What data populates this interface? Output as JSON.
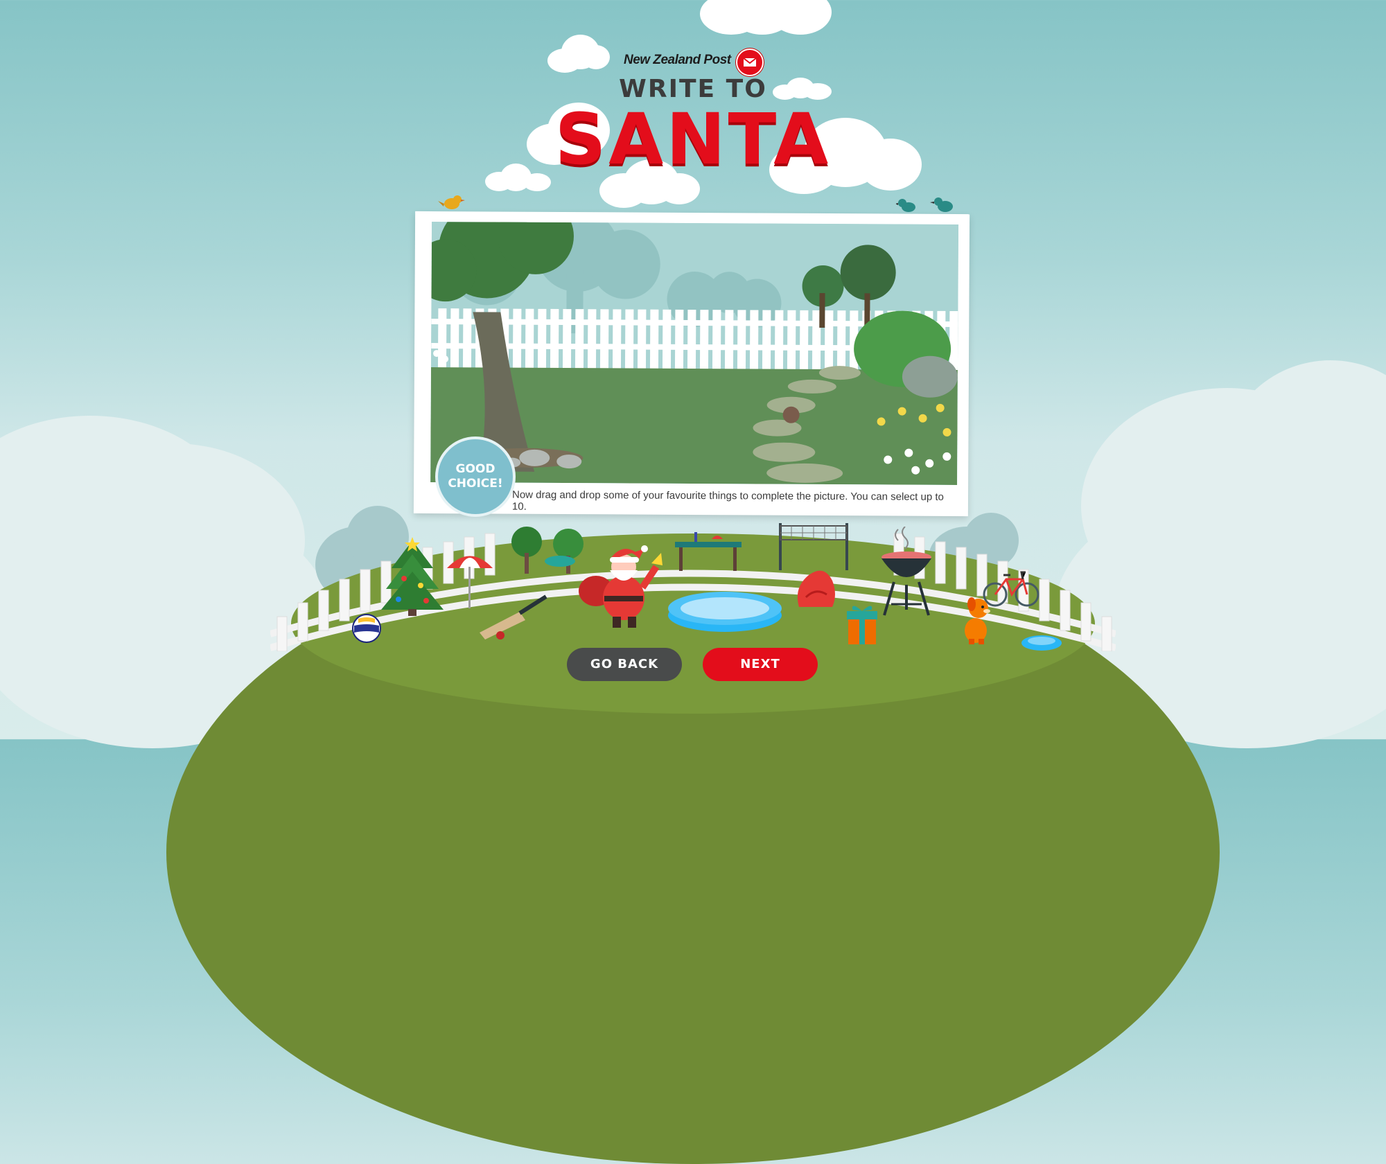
{
  "header": {
    "brand_name": "New Zealand Post",
    "title_line1": "WRITE TO",
    "title_line2": "SANTA"
  },
  "card": {
    "badge_text": "GOOD CHOICE!",
    "instruction": "Now drag and drop some of your favourite things to complete the picture. You can select up to 10."
  },
  "buttons": {
    "back_label": "GO BACK",
    "next_label": "NEXT"
  },
  "items": [
    {
      "name": "christmas-tree",
      "icon": "tree-icon"
    },
    {
      "name": "beach-umbrella",
      "icon": "umbrella-icon"
    },
    {
      "name": "trees",
      "icon": "trees-icon"
    },
    {
      "name": "hammock",
      "icon": "hammock-icon"
    },
    {
      "name": "santa",
      "icon": "santa-icon"
    },
    {
      "name": "picnic-table",
      "icon": "table-icon"
    },
    {
      "name": "badminton-net",
      "icon": "net-icon"
    },
    {
      "name": "barbecue",
      "icon": "bbq-icon"
    },
    {
      "name": "bicycle",
      "icon": "bicycle-icon"
    },
    {
      "name": "volleyball",
      "icon": "ball-icon"
    },
    {
      "name": "cricket-bat",
      "icon": "cricket-bat-icon"
    },
    {
      "name": "paddling-pool",
      "icon": "pool-icon"
    },
    {
      "name": "bean-bag",
      "icon": "beanbag-icon"
    },
    {
      "name": "gift",
      "icon": "gift-icon"
    },
    {
      "name": "dog",
      "icon": "dog-icon"
    },
    {
      "name": "frisbee",
      "icon": "frisbee-icon"
    }
  ],
  "colors": {
    "brand_red": "#e30d1b",
    "dark_button": "#494b4b",
    "sky": "#86c4c6",
    "grass": "#6f8b35"
  }
}
